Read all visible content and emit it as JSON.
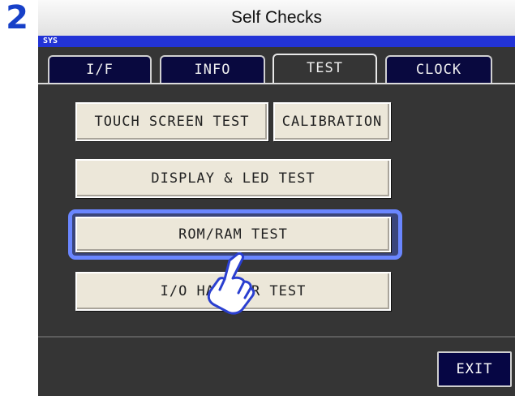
{
  "step": "2",
  "title": "Self Checks",
  "sys_label": "SYS",
  "tabs": [
    {
      "label": "I/F"
    },
    {
      "label": "INFO"
    },
    {
      "label": "TEST"
    },
    {
      "label": "CLOCK"
    }
  ],
  "active_tab": "TEST",
  "buttons": {
    "touch_screen": "TOUCH SCREEN TEST",
    "calibration": "CALIBRATION",
    "display_led": "DISPLAY & LED TEST",
    "rom_ram": "ROM/RAM TEST",
    "io_handler": "I/O HANDLER TEST"
  },
  "exit_label": "EXIT",
  "colors": {
    "step_number": "#1740c8",
    "sys_bar": "#2233d6",
    "tab_inactive": "#09093f",
    "panel_bg": "#353535",
    "button_face": "#ece7d9",
    "highlight": "#6a86ff",
    "exit_button": "#060644"
  }
}
